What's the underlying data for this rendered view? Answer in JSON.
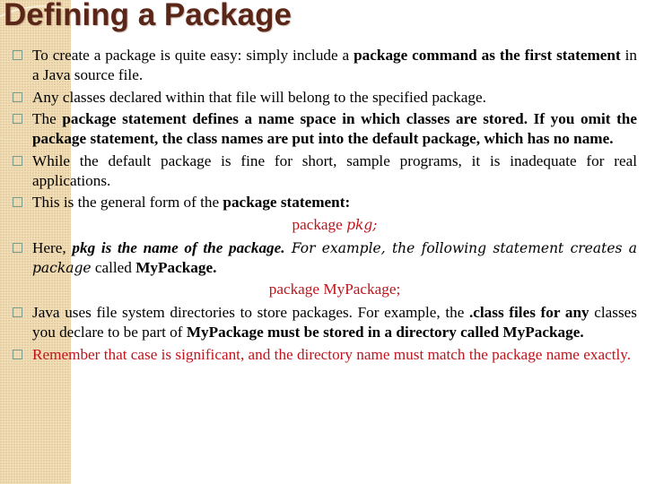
{
  "slide": {
    "title": "Defining a Package",
    "bullets": [
      {
        "parts": [
          {
            "text": "To create a package is quite easy: simply include a ",
            "style": "normal"
          },
          {
            "text": "package command as the first statement",
            "style": "bold"
          },
          {
            "text": " in a Java source file.",
            "style": "normal"
          }
        ]
      },
      {
        "parts": [
          {
            "text": "Any classes declared within that file will belong to the specified package.",
            "style": "normal"
          }
        ]
      },
      {
        "parts": [
          {
            "text": "The ",
            "style": "normal"
          },
          {
            "text": "package statement defines a name space in which classes are stored. If you omit the package statement, the class names are put into the default package, which has no name.",
            "style": "bold"
          }
        ]
      },
      {
        "parts": [
          {
            "text": "While the default package is fine for short, sample programs, it is inadequate for real applications.",
            "style": "normal"
          }
        ]
      },
      {
        "parts": [
          {
            "text": "This is the general form of the ",
            "style": "normal"
          },
          {
            "text": "package statement:",
            "style": "bold"
          }
        ]
      },
      {
        "parts": [
          {
            "text": "Here, ",
            "style": "normal"
          },
          {
            "text": "pkg is the name of the package.",
            "style": "bold-italic"
          },
          {
            "text": " For example, the following statement creates a package",
            "style": "italic"
          },
          {
            "text": " called ",
            "style": "normal"
          },
          {
            "text": "MyPackage.",
            "style": "bold"
          }
        ]
      },
      {
        "parts": [
          {
            "text": "Java uses file system directories to store packages. For example, the ",
            "style": "normal"
          },
          {
            "text": ".class files for any",
            "style": "bold"
          },
          {
            "text": " classes you declare to be part of ",
            "style": "normal"
          },
          {
            "text": "MyPackage must be stored in a directory called MyPackage.",
            "style": "bold"
          }
        ]
      },
      {
        "color": "red",
        "parts": [
          {
            "text": "Remember that case is significant, and the directory name must match the package name exactly.",
            "style": "normal"
          }
        ]
      }
    ],
    "code_general": {
      "keyword": "package ",
      "name": "pkg;"
    },
    "code_example": {
      "text": "package MyPackage;"
    }
  },
  "colors": {
    "title": "#5a2617",
    "accent_red": "#c0141c",
    "strip": "#f3dfb7",
    "bullet_box": "#7a9a8a"
  }
}
